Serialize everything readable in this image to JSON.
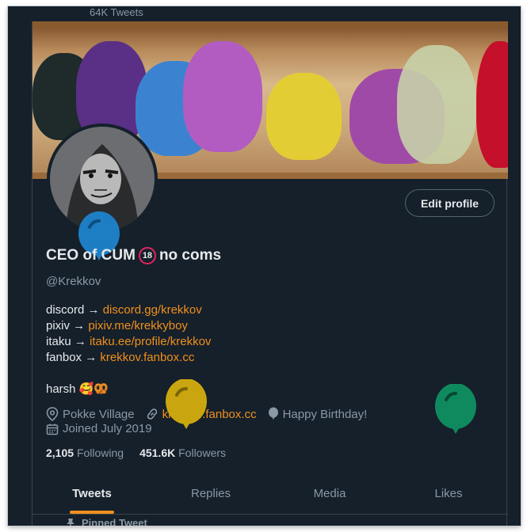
{
  "header": {
    "tweet_count": "64K Tweets"
  },
  "profile": {
    "edit_label": "Edit profile",
    "display_name": "CEO of CUM",
    "badge": "18",
    "name_suffix": "no coms",
    "handle": "@Krekkov"
  },
  "bio": {
    "lines": [
      {
        "prefix": "discord → ",
        "link": "discord.gg/krekkov"
      },
      {
        "prefix": "pixiv → ",
        "link": "pixiv.me/krekkyboy"
      },
      {
        "prefix": "itaku → ",
        "link": "itaku.ee/profile/krekkov"
      },
      {
        "prefix": "fanbox → ",
        "link": "krekkov.fanbox.cc"
      }
    ],
    "tagline": "harsh 🥰🥨"
  },
  "meta": {
    "location": "Pokke Village",
    "website": "krekkov.fanbox.cc",
    "birthday": "Happy Birthday!",
    "joined": "Joined July 2019"
  },
  "stats": {
    "following_count": "2,105",
    "following_label": "Following",
    "followers_count": "451.6K",
    "followers_label": "Followers"
  },
  "tabs": [
    {
      "label": "Tweets",
      "active": true
    },
    {
      "label": "Replies",
      "active": false
    },
    {
      "label": "Media",
      "active": false
    },
    {
      "label": "Likes",
      "active": false
    }
  ],
  "pinned": {
    "label": "Pinned Tweet"
  },
  "icons": {
    "location": "location-pin-icon",
    "website": "link-icon",
    "birthday": "balloon-icon",
    "joined": "calendar-icon",
    "pinned": "pin-icon"
  },
  "colors": {
    "background": "#15202b",
    "accent": "#f18f1c",
    "text_primary": "#e7e9ea",
    "text_secondary": "#8b98a5",
    "balloon_blue": "#1d7ec4",
    "balloon_yellow": "#c9a60f",
    "balloon_green": "#0f8a5e"
  }
}
